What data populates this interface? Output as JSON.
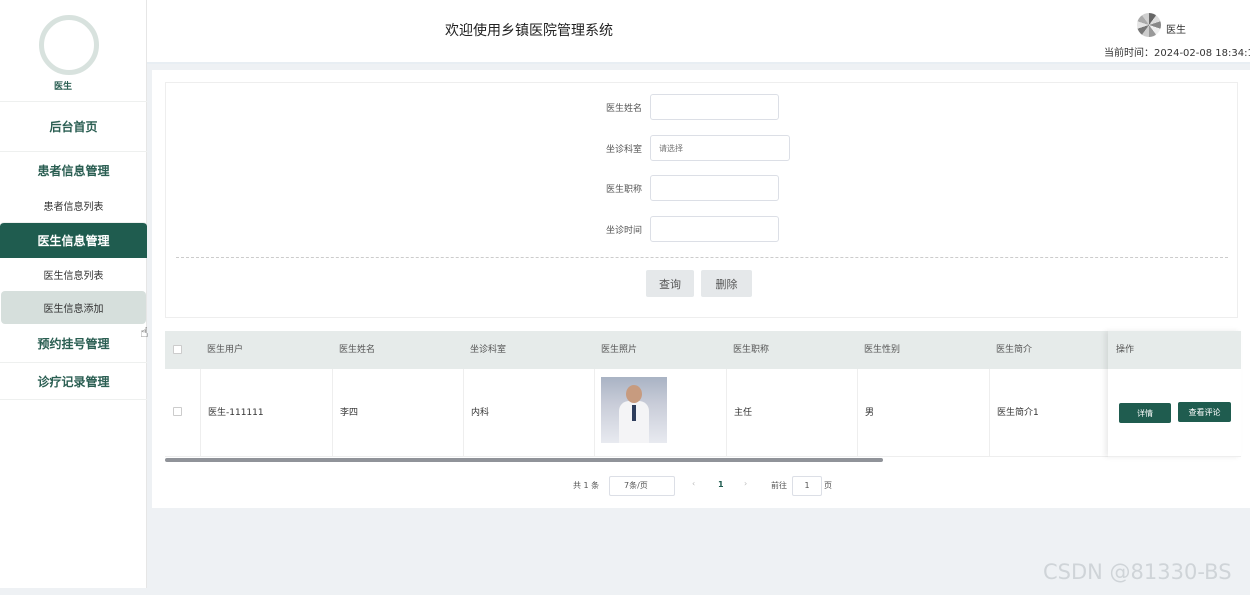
{
  "header": {
    "title": "欢迎使用乡镇医院管理系统",
    "user": "医生",
    "clock_label": "当前时间：",
    "clock_value": "2024-02-08 18:34:10"
  },
  "sidebar": {
    "user": "医生",
    "items": [
      {
        "label": "后台首页"
      },
      {
        "label": "患者信息管理"
      },
      {
        "label": "患者信息列表"
      },
      {
        "label": "医生信息管理"
      },
      {
        "label": "医生信息列表"
      },
      {
        "label": "医生信息添加"
      },
      {
        "label": "预约挂号管理"
      },
      {
        "label": "诊疗记录管理"
      }
    ]
  },
  "form": {
    "fields": [
      {
        "label": "医生姓名",
        "value": "",
        "placeholder": ""
      },
      {
        "label": "坐诊科室",
        "value": "",
        "placeholder": "请选择"
      },
      {
        "label": "医生职称",
        "value": "",
        "placeholder": ""
      },
      {
        "label": "坐诊时间",
        "value": "",
        "placeholder": ""
      }
    ],
    "query_label": "查询",
    "delete_label": "删除"
  },
  "table": {
    "headers": [
      "医生用户",
      "医生姓名",
      "坐诊科室",
      "医生照片",
      "医生职称",
      "医生性别",
      "医生简介",
      "操作"
    ],
    "rows": [
      {
        "user": "医生-111111",
        "name": "李四",
        "dept": "内科",
        "title": "主任",
        "gender": "男",
        "intro": "医生简介1",
        "detail_label": "详情",
        "review_label": "查看评论"
      }
    ]
  },
  "pager": {
    "total": "共 1 条",
    "page_size": "7条/页",
    "prev": "‹",
    "current": "1",
    "next": "›",
    "goto_label": "前往",
    "goto_value": "1",
    "goto_suffix": "页"
  },
  "watermark": "CSDN @81330-BS",
  "colors": {
    "accent": "#1f5c4f",
    "sub_active": "#d6dfdc",
    "table_header": "#e6ebea"
  }
}
